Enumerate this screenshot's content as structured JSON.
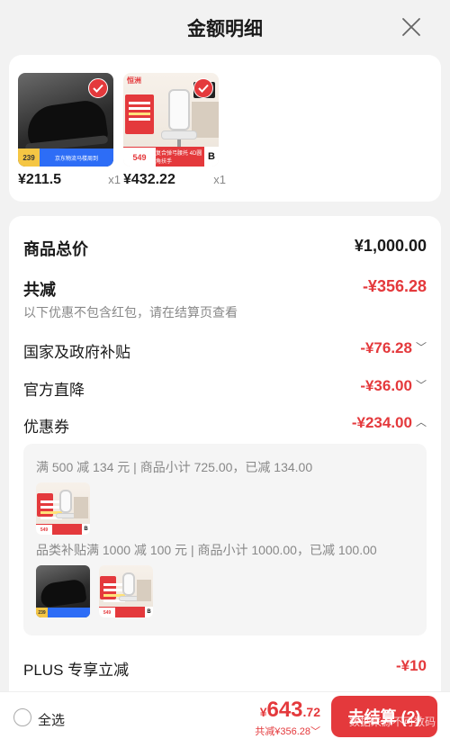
{
  "header": {
    "title": "金额明细"
  },
  "products": [
    {
      "price": "¥211.5",
      "qty": "x1",
      "tag_price": "239",
      "tag_text": "京东物流马楼周到"
    },
    {
      "price": "¥432.22",
      "qty": "x1",
      "tag_price": "549",
      "tag_text": "复合弹弓腰托 4D圆角扶手",
      "logo": "恒洲",
      "tag_letter": "B"
    }
  ],
  "summary": {
    "total_label": "商品总价",
    "total_value": "¥1,000.00",
    "reduce_label": "共减",
    "reduce_value": "-¥356.28",
    "note": "以下优惠不包含红包，请在结算页查看"
  },
  "discounts": [
    {
      "label": "国家及政府补贴",
      "value": "-¥76.28",
      "arrow": "﹀"
    },
    {
      "label": "官方直降",
      "value": "-¥36.00",
      "arrow": "﹀"
    },
    {
      "label": "优惠券",
      "value": "-¥234.00",
      "arrow": "︿"
    }
  ],
  "coupons": [
    {
      "rule": "满 500 减 134 元 | 商品小计 725.00，已减 134.00"
    },
    {
      "rule": "品类补贴满 1000 减 100 元 | 商品小计 1000.00，已减 100.00"
    }
  ],
  "plus": {
    "label": "PLUS 专享立减",
    "value": "-¥10"
  },
  "footer": {
    "select_all": "全选",
    "currency": "¥",
    "total_int": "643",
    "total_dec": ".72",
    "saved": "共减¥356.28",
    "saved_arrow": "﹀",
    "checkout": "去结算 (2)",
    "watermark": "数据来源不可数码"
  },
  "colors": {
    "accent": "#e4393c",
    "background": "#f2f2f2"
  }
}
